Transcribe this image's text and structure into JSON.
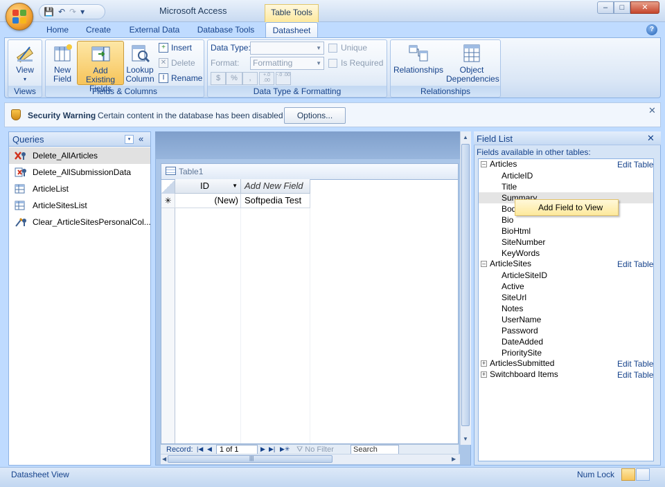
{
  "window": {
    "app_title": "Microsoft Access",
    "context_tab": "Table Tools",
    "qat_save": "💾",
    "qat_undo": "↶",
    "qat_redo": "↷",
    "qat_customize": "▾",
    "min": "–",
    "max": "□",
    "close": "✕"
  },
  "tabs": [
    "Home",
    "Create",
    "External Data",
    "Database Tools",
    "Datasheet"
  ],
  "active_tab": "Datasheet",
  "ribbon": {
    "views": {
      "label": "Views",
      "view_btn": "View",
      "view_arrow": "▾"
    },
    "fields_columns": {
      "label": "Fields & Columns",
      "new_field": [
        "New",
        "Field"
      ],
      "add_existing": [
        "Add Existing",
        "Fields"
      ],
      "lookup": [
        "Lookup",
        "Column"
      ],
      "insert": "Insert",
      "delete": "Delete",
      "rename": "Rename"
    },
    "data_type": {
      "label": "Data Type & Formatting",
      "data_type_label": "Data Type:",
      "data_type_value": "",
      "format_label": "Format:",
      "format_value": "Formatting",
      "unique": "Unique",
      "is_required": "Is Required",
      "currency": "$",
      "percent": "%",
      "comma": ",",
      "inc_dec": "+.0 .00",
      "dec_dec": "-.0 .00"
    },
    "relationships": {
      "label": "Relationships",
      "relationships_btn": "Relationships",
      "object_dep": [
        "Object",
        "Dependencies"
      ]
    }
  },
  "security": {
    "title": "Security Warning",
    "message": "Certain content in the database has been disabled",
    "options": "Options...",
    "close": "✕"
  },
  "nav": {
    "title": "Queries",
    "dropdown": "▾",
    "collapse": "«",
    "items": [
      {
        "label": "Delete_AllArticles",
        "selected": true
      },
      {
        "label": "Delete_AllSubmissionData",
        "selected": false
      },
      {
        "label": "ArticleList",
        "selected": false
      },
      {
        "label": "ArticleSitesList",
        "selected": false
      },
      {
        "label": "Clear_ArticleSitesPersonalCol...",
        "selected": false
      }
    ]
  },
  "document": {
    "tab_label": "Table1",
    "col_id": "ID",
    "col_add": "Add New Field",
    "row_marker": "✳",
    "row_new": "(New)",
    "row_value": "Softpedia Test",
    "record_label": "Record:",
    "record_of": "1 of 1",
    "no_filter": "No Filter",
    "search": "Search"
  },
  "field_list": {
    "title": "Field List",
    "close": "✕",
    "subtitle": "Fields available in other tables:",
    "edit_table": "Edit Table",
    "tables": [
      {
        "name": "Articles",
        "expanded": true,
        "fields": [
          "ArticleID",
          "Title",
          "Summary",
          "Body",
          "Bio",
          "BioHtml",
          "SiteNumber",
          "KeyWords"
        ]
      },
      {
        "name": "ArticleSites",
        "expanded": true,
        "fields": [
          "ArticleSiteID",
          "Active",
          "SiteUrl",
          "Notes",
          "UserName",
          "Password",
          "DateAdded",
          "PrioritySite"
        ]
      },
      {
        "name": "ArticlesSubmitted",
        "expanded": false,
        "fields": []
      },
      {
        "name": "Switchboard Items",
        "expanded": false,
        "fields": []
      }
    ],
    "tooltip": "Add Field to View"
  },
  "status": {
    "left": "Datasheet View",
    "numlock": "Num Lock"
  }
}
